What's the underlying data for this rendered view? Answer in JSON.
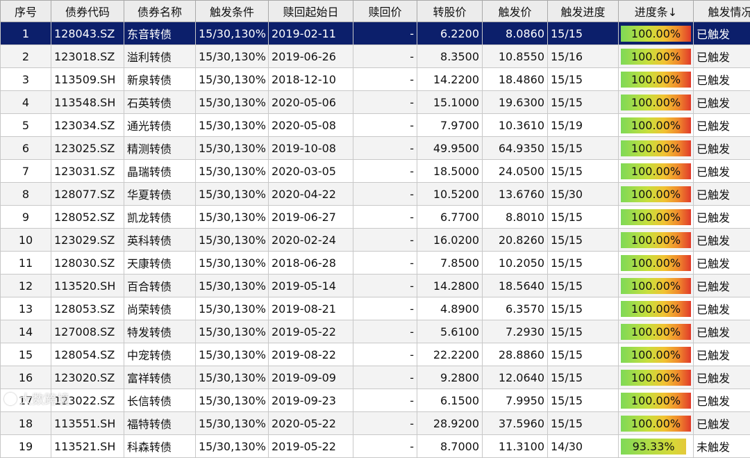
{
  "columns": [
    "序号",
    "债券代码",
    "债券名称",
    "触发条件",
    "赎回起始日",
    "赎回价",
    "转股价",
    "触发价",
    "触发进度",
    "进度条↓",
    "触发情况"
  ],
  "rows": [
    {
      "idx": "1",
      "code": "128043.SZ",
      "name": "东音转债",
      "cond": "15/30,130%",
      "date": "2019-02-11",
      "redeem": "-",
      "conv": "6.2200",
      "trigger": "8.0860",
      "prog": "15/15",
      "pct": "100.00%",
      "status": "已触发",
      "selected": true
    },
    {
      "idx": "2",
      "code": "123018.SZ",
      "name": "溢利转债",
      "cond": "15/30,130%",
      "date": "2019-06-26",
      "redeem": "-",
      "conv": "8.3500",
      "trigger": "10.8550",
      "prog": "15/16",
      "pct": "100.00%",
      "status": "已触发"
    },
    {
      "idx": "3",
      "code": "113509.SH",
      "name": "新泉转债",
      "cond": "15/30,130%",
      "date": "2018-12-10",
      "redeem": "-",
      "conv": "14.2200",
      "trigger": "18.4860",
      "prog": "15/15",
      "pct": "100.00%",
      "status": "已触发"
    },
    {
      "idx": "4",
      "code": "113548.SH",
      "name": "石英转债",
      "cond": "15/30,130%",
      "date": "2020-05-06",
      "redeem": "-",
      "conv": "15.1000",
      "trigger": "19.6300",
      "prog": "15/15",
      "pct": "100.00%",
      "status": "已触发"
    },
    {
      "idx": "5",
      "code": "123034.SZ",
      "name": "通光转债",
      "cond": "15/30,130%",
      "date": "2020-05-08",
      "redeem": "-",
      "conv": "7.9700",
      "trigger": "10.3610",
      "prog": "15/19",
      "pct": "100.00%",
      "status": "已触发"
    },
    {
      "idx": "6",
      "code": "123025.SZ",
      "name": "精测转债",
      "cond": "15/30,130%",
      "date": "2019-10-08",
      "redeem": "-",
      "conv": "49.9500",
      "trigger": "64.9350",
      "prog": "15/15",
      "pct": "100.00%",
      "status": "已触发"
    },
    {
      "idx": "7",
      "code": "123031.SZ",
      "name": "晶瑞转债",
      "cond": "15/30,130%",
      "date": "2020-03-05",
      "redeem": "-",
      "conv": "18.5000",
      "trigger": "24.0500",
      "prog": "15/15",
      "pct": "100.00%",
      "status": "已触发"
    },
    {
      "idx": "8",
      "code": "128077.SZ",
      "name": "华夏转债",
      "cond": "15/30,130%",
      "date": "2020-04-22",
      "redeem": "-",
      "conv": "10.5200",
      "trigger": "13.6760",
      "prog": "15/30",
      "pct": "100.00%",
      "status": "已触发"
    },
    {
      "idx": "9",
      "code": "128052.SZ",
      "name": "凯龙转债",
      "cond": "15/30,130%",
      "date": "2019-06-27",
      "redeem": "-",
      "conv": "6.7700",
      "trigger": "8.8010",
      "prog": "15/15",
      "pct": "100.00%",
      "status": "已触发"
    },
    {
      "idx": "10",
      "code": "123029.SZ",
      "name": "英科转债",
      "cond": "15/30,130%",
      "date": "2020-02-24",
      "redeem": "-",
      "conv": "16.0200",
      "trigger": "20.8260",
      "prog": "15/15",
      "pct": "100.00%",
      "status": "已触发"
    },
    {
      "idx": "11",
      "code": "128030.SZ",
      "name": "天康转债",
      "cond": "15/30,130%",
      "date": "2018-06-28",
      "redeem": "-",
      "conv": "7.8500",
      "trigger": "10.2050",
      "prog": "15/15",
      "pct": "100.00%",
      "status": "已触发"
    },
    {
      "idx": "12",
      "code": "113520.SH",
      "name": "百合转债",
      "cond": "15/30,130%",
      "date": "2019-05-14",
      "redeem": "-",
      "conv": "14.2800",
      "trigger": "18.5640",
      "prog": "15/15",
      "pct": "100.00%",
      "status": "已触发"
    },
    {
      "idx": "13",
      "code": "128053.SZ",
      "name": "尚荣转债",
      "cond": "15/30,130%",
      "date": "2019-08-21",
      "redeem": "-",
      "conv": "4.8900",
      "trigger": "6.3570",
      "prog": "15/15",
      "pct": "100.00%",
      "status": "已触发"
    },
    {
      "idx": "14",
      "code": "127008.SZ",
      "name": "特发转债",
      "cond": "15/30,130%",
      "date": "2019-05-22",
      "redeem": "-",
      "conv": "5.6100",
      "trigger": "7.2930",
      "prog": "15/15",
      "pct": "100.00%",
      "status": "已触发"
    },
    {
      "idx": "15",
      "code": "128054.SZ",
      "name": "中宠转债",
      "cond": "15/30,130%",
      "date": "2019-08-22",
      "redeem": "-",
      "conv": "22.2200",
      "trigger": "28.8860",
      "prog": "15/15",
      "pct": "100.00%",
      "status": "已触发"
    },
    {
      "idx": "16",
      "code": "123020.SZ",
      "name": "富祥转债",
      "cond": "15/30,130%",
      "date": "2019-09-09",
      "redeem": "-",
      "conv": "9.2800",
      "trigger": "12.0640",
      "prog": "15/15",
      "pct": "100.00%",
      "status": "已触发"
    },
    {
      "idx": "17",
      "code": "123022.SZ",
      "name": "长信转债",
      "cond": "15/30,130%",
      "date": "2019-09-23",
      "redeem": "-",
      "conv": "6.1500",
      "trigger": "7.9950",
      "prog": "15/15",
      "pct": "100.00%",
      "status": "已触发"
    },
    {
      "idx": "18",
      "code": "113551.SH",
      "name": "福特转债",
      "cond": "15/30,130%",
      "date": "2020-05-22",
      "redeem": "-",
      "conv": "28.9200",
      "trigger": "37.5960",
      "prog": "15/15",
      "pct": "100.00%",
      "status": "已触发"
    },
    {
      "idx": "19",
      "code": "113521.SH",
      "name": "科森转债",
      "cond": "15/30,130%",
      "date": "2019-05-22",
      "redeem": "-",
      "conv": "8.7000",
      "trigger": "11.3100",
      "prog": "14/30",
      "pct": "93.33%",
      "status": "未触发",
      "partial": true
    }
  ],
  "watermark": "大数跨境"
}
